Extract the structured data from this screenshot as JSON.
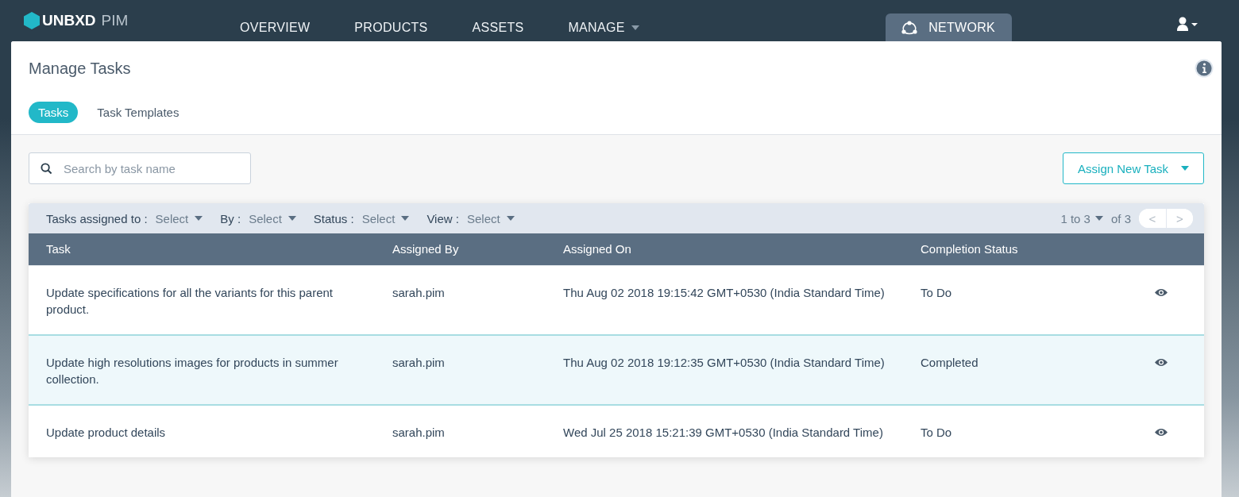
{
  "brand": {
    "name": "UNBXD",
    "product": "PIM"
  },
  "nav": [
    {
      "label": "OVERVIEW",
      "selected": false,
      "dropdown": false
    },
    {
      "label": "PRODUCTS",
      "selected": false,
      "dropdown": false
    },
    {
      "label": "ASSETS",
      "selected": false,
      "dropdown": false
    },
    {
      "label": "MANAGE",
      "selected": false,
      "dropdown": true
    }
  ],
  "network_tab": {
    "label": "NETWORK",
    "selected": true
  },
  "page_title": "Manage Tasks",
  "tabs": [
    {
      "label": "Tasks",
      "selected": true
    },
    {
      "label": "Task Templates",
      "selected": false
    }
  ],
  "search": {
    "placeholder": "Search by task name"
  },
  "assign_button": "Assign New Task",
  "filters": [
    {
      "label": "Tasks assigned to :",
      "value": "Select"
    },
    {
      "label": "By :",
      "value": "Select"
    },
    {
      "label": "Status :",
      "value": "Select"
    },
    {
      "label": "View :",
      "value": "Select"
    }
  ],
  "pagination": {
    "range": "1 to 3",
    "total": "of 3",
    "prev": "<",
    "next": ">"
  },
  "table": {
    "columns": [
      "Task",
      "Assigned By",
      "Assigned On",
      "Completion Status"
    ],
    "rows": [
      {
        "task": "Update specifications for all the variants for this parent product.",
        "assigned_by": "sarah.pim",
        "assigned_on": "Thu Aug 02 2018 19:15:42 GMT+0530 (India Standard Time)",
        "status": "To Do",
        "selected": false
      },
      {
        "task": "Update high resolutions images for products in summer collection.",
        "assigned_by": "sarah.pim",
        "assigned_on": "Thu Aug 02 2018 19:12:35 GMT+0530 (India Standard Time)",
        "status": "Completed",
        "selected": true
      },
      {
        "task": "Update product details",
        "assigned_by": "sarah.pim",
        "assigned_on": "Wed Jul 25 2018 15:21:39 GMT+0530 (India Standard Time)",
        "status": "To Do",
        "selected": false
      }
    ]
  }
}
